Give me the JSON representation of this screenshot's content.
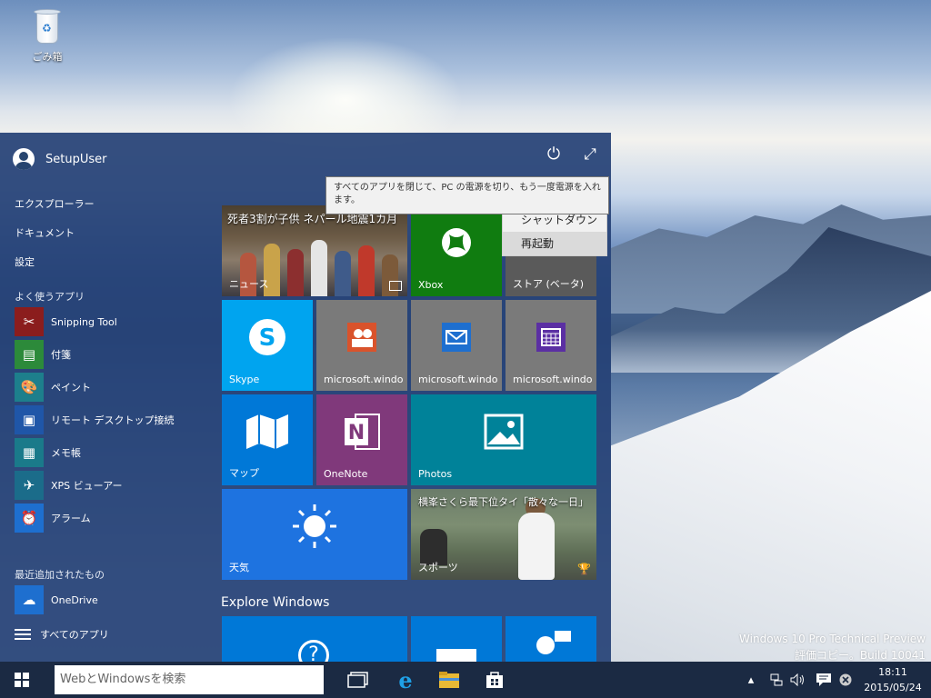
{
  "desktop": {
    "recycle_bin_label": "ごみ箱",
    "watermark_line1": "Windows 10 Pro Technical Preview",
    "watermark_line2": "評価コピー。Build 10041"
  },
  "start_menu": {
    "user_name": "SetupUser",
    "nav": {
      "explorer": "エクスプローラー",
      "documents": "ドキュメント",
      "settings": "設定"
    },
    "most_used_label": "よく使うアプリ",
    "most_used": [
      {
        "label": "Snipping Tool",
        "icon": "scissors-icon",
        "color": "#8b1d1d"
      },
      {
        "label": "付箋",
        "icon": "sticky-notes-icon",
        "color": "#2c8a3a"
      },
      {
        "label": "ペイント",
        "icon": "paint-palette-icon",
        "color": "#1d7f8c"
      },
      {
        "label": "リモート デスクトップ接続",
        "icon": "remote-desktop-icon",
        "color": "#1f56a8"
      },
      {
        "label": "メモ帳",
        "icon": "notepad-icon",
        "color": "#1a7a8a"
      },
      {
        "label": "XPS ビューアー",
        "icon": "xps-viewer-icon",
        "color": "#1b6c8a"
      },
      {
        "label": "アラーム",
        "icon": "alarm-clock-icon",
        "color": "#1e6fcf"
      }
    ],
    "recently_added_label": "最近追加されたもの",
    "recently_added": [
      {
        "label": "OneDrive",
        "icon": "onedrive-cloud-icon",
        "color": "#1e6fcf"
      }
    ],
    "all_apps_label": "すべてのアプリ",
    "tooltip_text": "すべてのアプリを閉じて、PC の電源を切り、もう一度電源を入れます。",
    "power_menu": {
      "shutdown": "シャットダウン",
      "restart": "再起動"
    },
    "tiles": {
      "news_headline": "死者3割が子供 ネパール地震1カ月",
      "news": "ニュース",
      "xbox": "Xbox",
      "store": "ストア (ベータ)",
      "skype": "Skype",
      "people": "microsoft.windo",
      "mail": "microsoft.windo",
      "calendar": "microsoft.windo",
      "maps": "マップ",
      "onenote": "OneNote",
      "photos": "Photos",
      "weather": "天気",
      "sports_headline": "横峯さくら最下位タイ「散々な一日」",
      "sports": "スポーツ"
    },
    "explore_title": "Explore Windows",
    "colors": {
      "xbox": "#107c10",
      "skype": "#00a4ef",
      "grey_tile": "#7a7a7a",
      "maps": "#0078d7",
      "onenote": "#80397b",
      "photos": "#008299",
      "weather": "#1e73e0",
      "store_tile": "#5a5a5a"
    }
  },
  "taskbar": {
    "search_placeholder": "WebとWindowsを検索",
    "time": "18:11",
    "date": "2015/05/24"
  }
}
